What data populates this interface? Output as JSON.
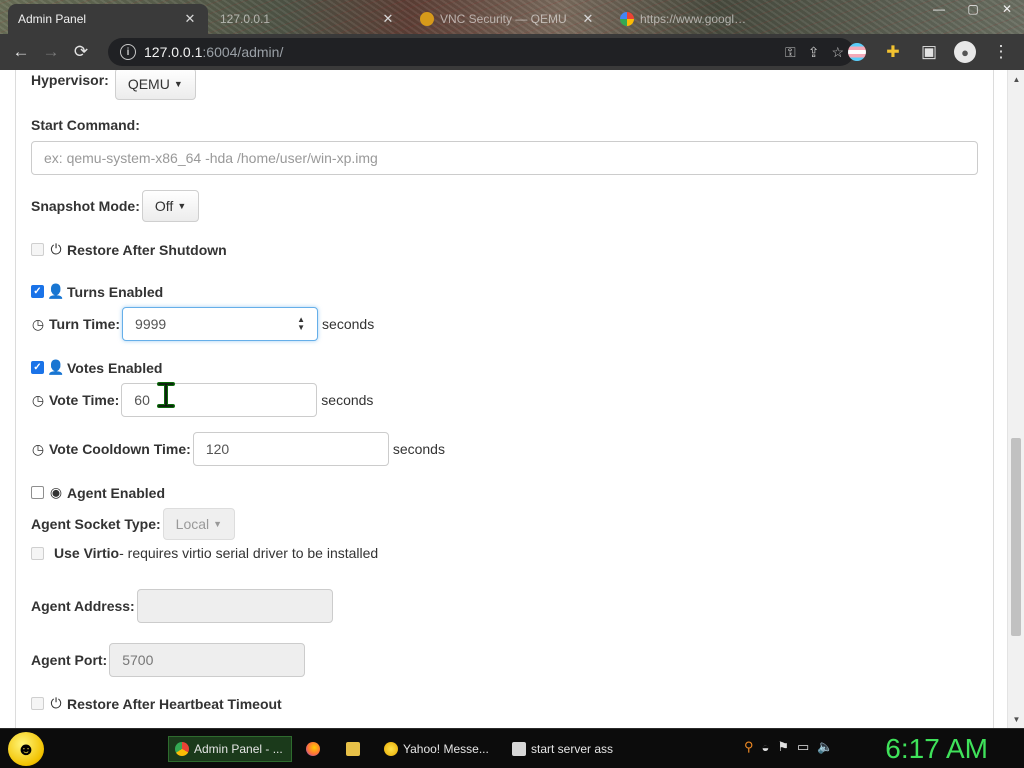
{
  "browser": {
    "tabs": [
      {
        "label": "Admin Panel",
        "active": true
      },
      {
        "label": "127.0.0.1",
        "active": false
      },
      {
        "label": "VNC Security — QEMU",
        "active": false
      },
      {
        "label": "https://www.google...",
        "active": false
      }
    ],
    "url_host": "127.0.0.1",
    "url_rest": ":6004/admin/",
    "window_controls": {
      "minimize": "—",
      "maximize": "▢",
      "close": "✕"
    }
  },
  "form": {
    "hypervisor": {
      "label": "Hypervisor:",
      "value": "QEMU"
    },
    "start_command": {
      "label": "Start Command:",
      "placeholder": "ex: qemu-system-x86_64 -hda /home/user/win-xp.img"
    },
    "snapshot_mode": {
      "label": "Snapshot Mode:",
      "value": "Off"
    },
    "restore_after_shutdown": {
      "label": "Restore After Shutdown",
      "checked": false
    },
    "turns_enabled": {
      "label": "Turns Enabled",
      "checked": true
    },
    "turn_time": {
      "label": "Turn Time:",
      "value": "9999",
      "units": "seconds"
    },
    "votes_enabled": {
      "label": "Votes Enabled",
      "checked": true
    },
    "vote_time": {
      "label": "Vote Time:",
      "value": "60",
      "units": "seconds"
    },
    "vote_cooldown": {
      "label": "Vote Cooldown Time:",
      "value": "120",
      "units": "seconds"
    },
    "agent_enabled": {
      "label": "Agent Enabled",
      "checked": false
    },
    "agent_socket_type": {
      "label": "Agent Socket Type:",
      "value": "Local"
    },
    "use_virtio": {
      "label": "Use Virtio",
      "hint": "- requires virtio serial driver to be installed",
      "checked": false
    },
    "agent_address": {
      "label": "Agent Address:",
      "value": ""
    },
    "agent_port": {
      "label": "Agent Port:",
      "value": "5700"
    },
    "restore_after_heartbeat": {
      "label": "Restore After Heartbeat Timeout",
      "checked": false
    }
  },
  "taskbar": {
    "items": [
      {
        "label": "Admin Panel - ...",
        "icon": "chrome-icon"
      },
      {
        "label": "",
        "icon": "firefox-icon"
      },
      {
        "label": "",
        "icon": "folder-icon"
      },
      {
        "label": "Yahoo! Messe...",
        "icon": "yahoo-icon"
      },
      {
        "label": "start server ass",
        "icon": "terminal-icon"
      }
    ],
    "clock": "6:17 AM"
  },
  "colors": {
    "accent": "#1a73e8",
    "clock": "#3fe25a",
    "focus_ring": "#66afe9"
  }
}
